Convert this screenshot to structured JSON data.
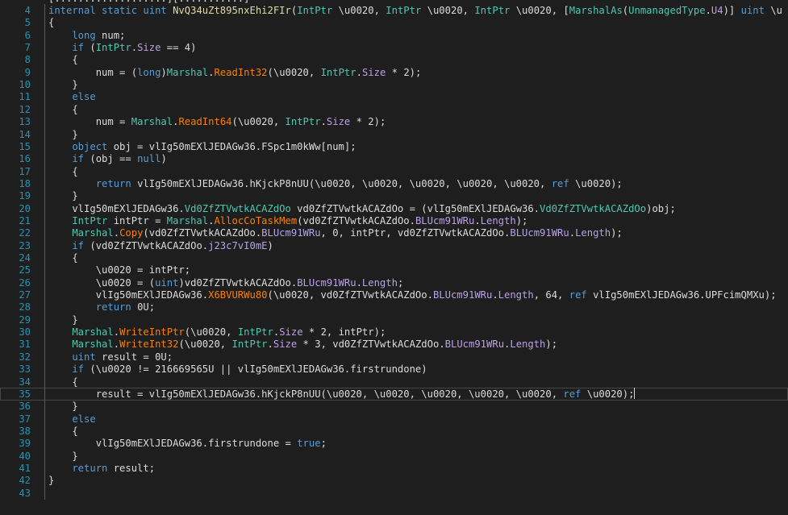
{
  "editor": {
    "top_fragment": "[...................][...........]",
    "lines": [
      {
        "n": "4",
        "segs": [
          [
            "kw",
            "internal static uint "
          ],
          [
            "mt2",
            "NvQ34uZt895nxEhi2FIr"
          ],
          [
            "tx",
            "("
          ],
          [
            "ty",
            "IntPtr"
          ],
          [
            "tx",
            " \\u0020, "
          ],
          [
            "ty",
            "IntPtr"
          ],
          [
            "tx",
            " \\u0020, "
          ],
          [
            "ty",
            "IntPtr"
          ],
          [
            "tx",
            " \\u0020, ["
          ],
          [
            "ty",
            "MarshalAs"
          ],
          [
            "tx",
            "("
          ],
          [
            "ty",
            "UnmanagedType"
          ],
          [
            "tx",
            "."
          ],
          [
            "pr",
            "U4"
          ],
          [
            "tx",
            ")] "
          ],
          [
            "kw",
            "uint"
          ],
          [
            "tx",
            " \\u"
          ]
        ]
      },
      {
        "n": "5",
        "segs": [
          [
            "tx",
            "{"
          ]
        ]
      },
      {
        "n": "6",
        "segs": [
          [
            "kw",
            "    long"
          ],
          [
            "tx",
            " num;"
          ]
        ]
      },
      {
        "n": "7",
        "segs": [
          [
            "kw",
            "    if"
          ],
          [
            "tx",
            " ("
          ],
          [
            "ty",
            "IntPtr"
          ],
          [
            "tx",
            "."
          ],
          [
            "pr",
            "Size"
          ],
          [
            "tx",
            " == 4)"
          ]
        ]
      },
      {
        "n": "8",
        "segs": [
          [
            "tx",
            "    {"
          ]
        ]
      },
      {
        "n": "9",
        "segs": [
          [
            "tx",
            "        num = ("
          ],
          [
            "kw",
            "long"
          ],
          [
            "tx",
            ")"
          ],
          [
            "ty",
            "Marshal"
          ],
          [
            "tx",
            "."
          ],
          [
            "mt",
            "ReadInt32"
          ],
          [
            "tx",
            "(\\u0020, "
          ],
          [
            "ty",
            "IntPtr"
          ],
          [
            "tx",
            "."
          ],
          [
            "pr",
            "Size"
          ],
          [
            "tx",
            " * 2);"
          ]
        ]
      },
      {
        "n": "10",
        "segs": [
          [
            "tx",
            "    }"
          ]
        ]
      },
      {
        "n": "11",
        "segs": [
          [
            "kw",
            "    else"
          ]
        ]
      },
      {
        "n": "12",
        "segs": [
          [
            "tx",
            "    {"
          ]
        ]
      },
      {
        "n": "13",
        "segs": [
          [
            "tx",
            "        num = "
          ],
          [
            "ty",
            "Marshal"
          ],
          [
            "tx",
            "."
          ],
          [
            "mt",
            "ReadInt64"
          ],
          [
            "tx",
            "(\\u0020, "
          ],
          [
            "ty",
            "IntPtr"
          ],
          [
            "tx",
            "."
          ],
          [
            "pr",
            "Size"
          ],
          [
            "tx",
            " * 2);"
          ]
        ]
      },
      {
        "n": "14",
        "segs": [
          [
            "tx",
            "    }"
          ]
        ]
      },
      {
        "n": "15",
        "segs": [
          [
            "kw",
            "    object"
          ],
          [
            "tx",
            " obj = vlIg50mEXlJEDAGw36."
          ],
          [
            "tx",
            "FSpc1m0kWw"
          ],
          [
            "tx",
            "[num];"
          ]
        ]
      },
      {
        "n": "16",
        "segs": [
          [
            "kw",
            "    if"
          ],
          [
            "tx",
            " (obj == "
          ],
          [
            "kw",
            "null"
          ],
          [
            "tx",
            ")"
          ]
        ]
      },
      {
        "n": "17",
        "segs": [
          [
            "tx",
            "    {"
          ]
        ]
      },
      {
        "n": "18",
        "segs": [
          [
            "kw",
            "        return"
          ],
          [
            "tx",
            " vlIg50mEXlJEDAGw36."
          ],
          [
            "tx",
            "hKjckP8nUU"
          ],
          [
            "tx",
            "(\\u0020, \\u0020, \\u0020, \\u0020, \\u0020, "
          ],
          [
            "kw",
            "ref"
          ],
          [
            "tx",
            " \\u0020);"
          ]
        ]
      },
      {
        "n": "19",
        "segs": [
          [
            "tx",
            "    }"
          ]
        ]
      },
      {
        "n": "20",
        "segs": [
          [
            "tx",
            "    vlIg50mEXlJEDAGw36."
          ],
          [
            "ty",
            "Vd0ZfZTVwtkACAZdOo"
          ],
          [
            "tx",
            " vd0ZfZTVwtkACAZdOo = (vlIg50mEXlJEDAGw36."
          ],
          [
            "ty",
            "Vd0ZfZTVwtkACAZdOo"
          ],
          [
            "tx",
            ")obj;"
          ]
        ]
      },
      {
        "n": "21",
        "segs": [
          [
            "ty",
            "    IntPtr"
          ],
          [
            "tx",
            " intPtr = "
          ],
          [
            "ty",
            "Marshal"
          ],
          [
            "tx",
            "."
          ],
          [
            "mt",
            "AllocCoTaskMem"
          ],
          [
            "tx",
            "(vd0ZfZTVwtkACAZdOo."
          ],
          [
            "pr",
            "BLUcm91WRu"
          ],
          [
            "tx",
            "."
          ],
          [
            "pr",
            "Length"
          ],
          [
            "tx",
            ");"
          ]
        ]
      },
      {
        "n": "22",
        "segs": [
          [
            "ty",
            "    Marshal"
          ],
          [
            "tx",
            "."
          ],
          [
            "mt",
            "Copy"
          ],
          [
            "tx",
            "(vd0ZfZTVwtkACAZdOo."
          ],
          [
            "pr",
            "BLUcm91WRu"
          ],
          [
            "tx",
            ", 0, intPtr, vd0ZfZTVwtkACAZdOo."
          ],
          [
            "pr",
            "BLUcm91WRu"
          ],
          [
            "tx",
            "."
          ],
          [
            "pr",
            "Length"
          ],
          [
            "tx",
            ");"
          ]
        ]
      },
      {
        "n": "23",
        "segs": [
          [
            "kw",
            "    if"
          ],
          [
            "tx",
            " (vd0ZfZTVwtkACAZdOo."
          ],
          [
            "pr",
            "j23c7vI0mE"
          ],
          [
            "tx",
            ")"
          ]
        ]
      },
      {
        "n": "24",
        "segs": [
          [
            "tx",
            "    {"
          ]
        ]
      },
      {
        "n": "25",
        "segs": [
          [
            "tx",
            "        \\u0020 = intPtr;"
          ]
        ]
      },
      {
        "n": "26",
        "segs": [
          [
            "tx",
            "        \\u0020 = ("
          ],
          [
            "kw",
            "uint"
          ],
          [
            "tx",
            ")vd0ZfZTVwtkACAZdOo."
          ],
          [
            "pr",
            "BLUcm91WRu"
          ],
          [
            "tx",
            "."
          ],
          [
            "pr",
            "Length"
          ],
          [
            "tx",
            ";"
          ]
        ]
      },
      {
        "n": "27",
        "segs": [
          [
            "tx",
            "        vlIg50mEXlJEDAGw36."
          ],
          [
            "mt",
            "X6BVURWu80"
          ],
          [
            "tx",
            "(\\u0020, vd0ZfZTVwtkACAZdOo."
          ],
          [
            "pr",
            "BLUcm91WRu"
          ],
          [
            "tx",
            "."
          ],
          [
            "pr",
            "Length"
          ],
          [
            "tx",
            ", 64, "
          ],
          [
            "kw",
            "ref"
          ],
          [
            "tx",
            " vlIg50mEXlJEDAGw36."
          ],
          [
            "tx",
            "UPFcimQMXu"
          ],
          [
            "tx",
            ");"
          ]
        ]
      },
      {
        "n": "28",
        "segs": [
          [
            "kw",
            "        return"
          ],
          [
            "tx",
            " 0U;"
          ]
        ]
      },
      {
        "n": "29",
        "segs": [
          [
            "tx",
            "    }"
          ]
        ]
      },
      {
        "n": "30",
        "segs": [
          [
            "ty",
            "    Marshal"
          ],
          [
            "tx",
            "."
          ],
          [
            "mt",
            "WriteIntPtr"
          ],
          [
            "tx",
            "(\\u0020, "
          ],
          [
            "ty",
            "IntPtr"
          ],
          [
            "tx",
            "."
          ],
          [
            "pr",
            "Size"
          ],
          [
            "tx",
            " * 2, intPtr);"
          ]
        ]
      },
      {
        "n": "31",
        "segs": [
          [
            "ty",
            "    Marshal"
          ],
          [
            "tx",
            "."
          ],
          [
            "mt",
            "WriteInt32"
          ],
          [
            "tx",
            "(\\u0020, "
          ],
          [
            "ty",
            "IntPtr"
          ],
          [
            "tx",
            "."
          ],
          [
            "pr",
            "Size"
          ],
          [
            "tx",
            " * 3, vd0ZfZTVwtkACAZdOo."
          ],
          [
            "pr",
            "BLUcm91WRu"
          ],
          [
            "tx",
            "."
          ],
          [
            "pr",
            "Length"
          ],
          [
            "tx",
            ");"
          ]
        ]
      },
      {
        "n": "32",
        "segs": [
          [
            "kw",
            "    uint"
          ],
          [
            "tx",
            " result = 0U;"
          ]
        ]
      },
      {
        "n": "33",
        "segs": [
          [
            "kw",
            "    if"
          ],
          [
            "tx",
            " (\\u0020 != 216669565U || vlIg50mEXlJEDAGw36."
          ],
          [
            "tx",
            "firstrundone"
          ],
          [
            "tx",
            ")"
          ]
        ]
      },
      {
        "n": "34",
        "segs": [
          [
            "tx",
            "    {"
          ]
        ]
      },
      {
        "n": "35",
        "segs": [
          [
            "tx",
            "        result = vlIg50mEXlJEDAGw36."
          ],
          [
            "tx",
            "hKjckP8nUU"
          ],
          [
            "tx",
            "(\\u0020, \\u0020, \\u0020, \\u0020, \\u0020, "
          ],
          [
            "kw",
            "ref"
          ],
          [
            "tx",
            " \\u0020);"
          ]
        ],
        "current": true
      },
      {
        "n": "36",
        "segs": [
          [
            "tx",
            "    }"
          ]
        ]
      },
      {
        "n": "37",
        "segs": [
          [
            "kw",
            "    else"
          ]
        ]
      },
      {
        "n": "38",
        "segs": [
          [
            "tx",
            "    {"
          ]
        ]
      },
      {
        "n": "39",
        "segs": [
          [
            "tx",
            "        vlIg50mEXlJEDAGw36."
          ],
          [
            "tx",
            "firstrundone"
          ],
          [
            "tx",
            " = "
          ],
          [
            "kw",
            "true"
          ],
          [
            "tx",
            ";"
          ]
        ]
      },
      {
        "n": "40",
        "segs": [
          [
            "tx",
            "    }"
          ]
        ]
      },
      {
        "n": "41",
        "segs": [
          [
            "kw",
            "    return"
          ],
          [
            "tx",
            " result;"
          ]
        ]
      },
      {
        "n": "42",
        "segs": [
          [
            "tx",
            "}"
          ]
        ]
      },
      {
        "n": "43",
        "segs": []
      }
    ]
  }
}
